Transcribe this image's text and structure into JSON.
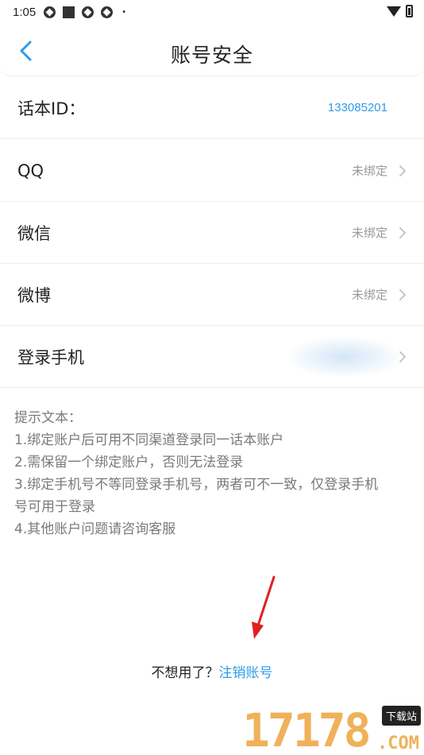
{
  "status_bar": {
    "time": "1:05",
    "dot": "•",
    "icons": [
      "app-notification-icon",
      "square-notification-icon",
      "app-notification-icon",
      "app-notification-icon",
      "wifi-icon",
      "battery-icon"
    ]
  },
  "header": {
    "title": "账号安全",
    "back_icon": "chevron-left-icon",
    "accent": "#2f9be8"
  },
  "rows": [
    {
      "label": "话本ID：",
      "value": "133085201"
    },
    {
      "label": "QQ",
      "value": "未绑定"
    },
    {
      "label": "微信",
      "value": "未绑定"
    },
    {
      "label": "微博",
      "value": "未绑定"
    },
    {
      "label": "登录手机",
      "value": ""
    }
  ],
  "tips": [
    "提示文本：",
    "1.绑定账户后可用不同渠道登录同一话本账户",
    "2.需保留一个绑定账户，否则无法登录",
    "3.绑定手机号不等同登录手机号，两者可不一致，仅登录手机",
    "号可用于登录",
    "4.其他账户问题请咨询客服"
  ],
  "footer": {
    "prompt": "不想用了？",
    "link": "注销账号"
  },
  "watermark": {
    "digits": "17178",
    "badge": "下载站",
    "suffix": ".COM"
  },
  "colors": {
    "link": "#2f9be8",
    "muted": "#999999",
    "annotation_arrow": "#e02020"
  }
}
